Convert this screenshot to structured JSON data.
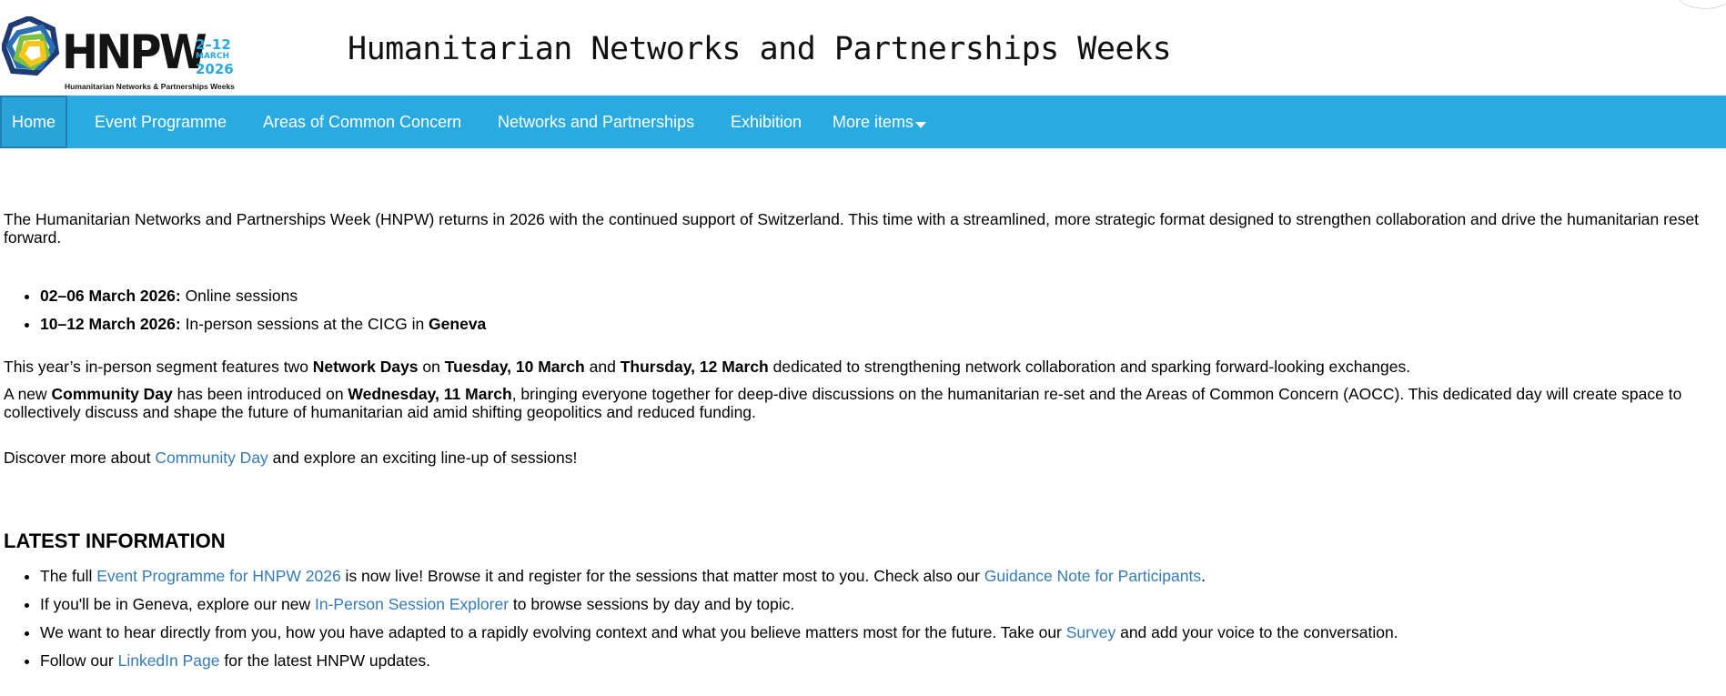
{
  "logo": {
    "word": "HNPW",
    "dates_line1": "2–12",
    "dates_line2": "MARCH",
    "dates_line3": "2026",
    "tagline": "Humanitarian Networks & Partnerships Weeks",
    "colors": {
      "blue": "#2a6fb5",
      "green": "#7bc043",
      "yellow": "#f5c518",
      "navy": "#1f3b73"
    }
  },
  "header": {
    "title": "Humanitarian Networks and Partnerships Weeks"
  },
  "nav": {
    "items": [
      {
        "label": "Home"
      },
      {
        "label": "Event Programme"
      },
      {
        "label": "Areas of Common Concern"
      },
      {
        "label": "Networks and Partnerships"
      },
      {
        "label": "Exhibition"
      },
      {
        "label": "More items"
      }
    ],
    "background": "#29abe2"
  },
  "intro": "The Humanitarian Networks and Partnerships Week (HNPW) returns in 2026 with the continued support of Switzerland. This time with a streamlined, more strategic format designed to strengthen collaboration and drive the humanitarian reset forward.",
  "dates": [
    {
      "bold": "02–06 March 2026:",
      "text": " Online sessions"
    },
    {
      "bold": "10–12 March 2026:",
      "text": " In-person sessions at the CICG in ",
      "bold2": "Geneva"
    }
  ],
  "segment": {
    "t1": "This year’s in-person segment features two ",
    "b1": "Network Days",
    "t2": " on ",
    "b2": "Tuesday, 10 March",
    "t3": " and ",
    "b3": "Thursday, 12 March",
    "t4": " dedicated to strengthening network collaboration and sparking forward-looking exchanges."
  },
  "community": {
    "t1": "A new ",
    "b1": "Community Day",
    "t2": " has been introduced on ",
    "b2": "Wednesday, 11 March",
    "t3": ", bringing everyone together for deep-dive discussions on the humanitarian re-set and the Areas of Common Concern (AOCC). This dedicated day will create space to collectively discuss and shape the future of humanitarian aid amid shifting geopolitics and reduced funding."
  },
  "discover": {
    "t1": "Discover more about ",
    "link": "Community Day",
    "t2": " and explore an exciting line-up of sessions!"
  },
  "latest": {
    "heading": "LATEST INFORMATION",
    "item1": {
      "t1": "The full ",
      "link1": "Event Programme for HNPW 2026",
      "t2": " is now live! Browse it and register for the sessions that matter most to you. Check also our ",
      "link2": "Guidance Note for Participants",
      "t3": "."
    },
    "item2": {
      "t1": "If you'll be in Geneva, explore our new ",
      "link1": "In-Person Session Explorer",
      "t2": " to browse sessions by day and by topic."
    },
    "item3": {
      "t1": "We want to hear directly from you, how you have adapted to a rapidly evolving context and what you believe matters most for the future. Take our ",
      "link1": "Survey",
      "t2": " and add your voice to the conversation."
    },
    "item4": {
      "t1": "Follow our ",
      "link1": "LinkedIn Page",
      "t2": " for the latest HNPW updates."
    }
  },
  "link_color": "#337ab7"
}
